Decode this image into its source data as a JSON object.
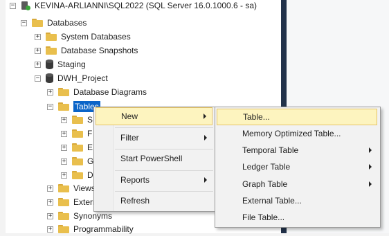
{
  "tree": {
    "server": "KEVINA-ARLIANNI\\SQL2022 (SQL Server 16.0.1000.6 - sa)",
    "databases": "Databases",
    "system_databases": "System Databases",
    "database_snapshots": "Database Snapshots",
    "staging": "Staging",
    "dwh_project": "DWH_Project",
    "database_diagrams": "Database Diagrams",
    "tables": "Tables",
    "child_s": "S",
    "child_f": "F",
    "child_e": "E",
    "child_g": "G",
    "child_d": "D",
    "views": "Views",
    "external": "External Resources",
    "synonyms": "Synonyms",
    "programmability": "Programmability",
    "expand_plus": "+",
    "expand_minus": "−"
  },
  "context_menu": {
    "items": [
      {
        "label": "New",
        "submenu": true,
        "highlighted": true
      },
      {
        "label": "Filter",
        "submenu": true
      },
      {
        "label": "Start PowerShell",
        "submenu": false
      },
      {
        "label": "Reports",
        "submenu": true
      },
      {
        "label": "Refresh",
        "submenu": false
      }
    ]
  },
  "new_submenu": {
    "items": [
      {
        "label": "Table...",
        "submenu": false,
        "highlighted": true
      },
      {
        "label": "Memory Optimized Table...",
        "submenu": false
      },
      {
        "label": "Temporal Table",
        "submenu": true
      },
      {
        "label": "Ledger Table",
        "submenu": true
      },
      {
        "label": "Graph Table",
        "submenu": true
      },
      {
        "label": "External Table...",
        "submenu": false
      },
      {
        "label": "File Table...",
        "submenu": false
      }
    ]
  },
  "colors": {
    "selection": "#0a64c8",
    "menu_highlight": "#fdf4bf",
    "menu_highlight_border": "#e5c365",
    "folder": "#e9bf4d",
    "divider": "#22324a"
  }
}
